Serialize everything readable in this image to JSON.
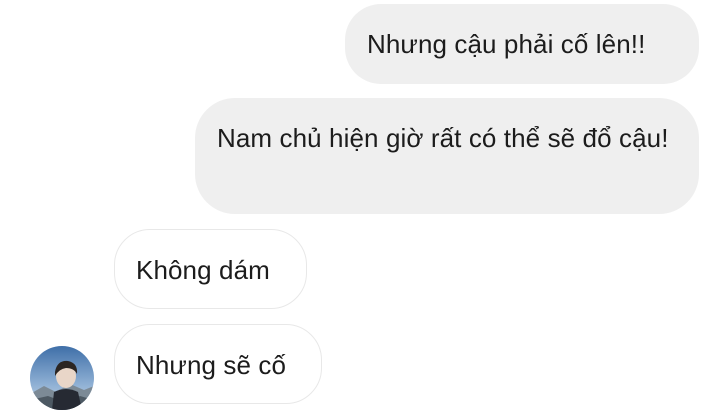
{
  "messages": [
    {
      "direction": "sent",
      "text": "Nhưng cậu phải cố lên!!"
    },
    {
      "direction": "sent",
      "text": "Nam chủ hiện giờ rất có thể sẽ đổ cậu!"
    },
    {
      "direction": "received",
      "text": "Không dám"
    },
    {
      "direction": "received",
      "text": "Nhưng sẽ cố"
    }
  ],
  "colors": {
    "sent_bubble": "#efefef",
    "received_border": "#e8e8e8",
    "text": "#1c1c1c"
  },
  "avatar": {
    "icon": "user-avatar-photo"
  }
}
